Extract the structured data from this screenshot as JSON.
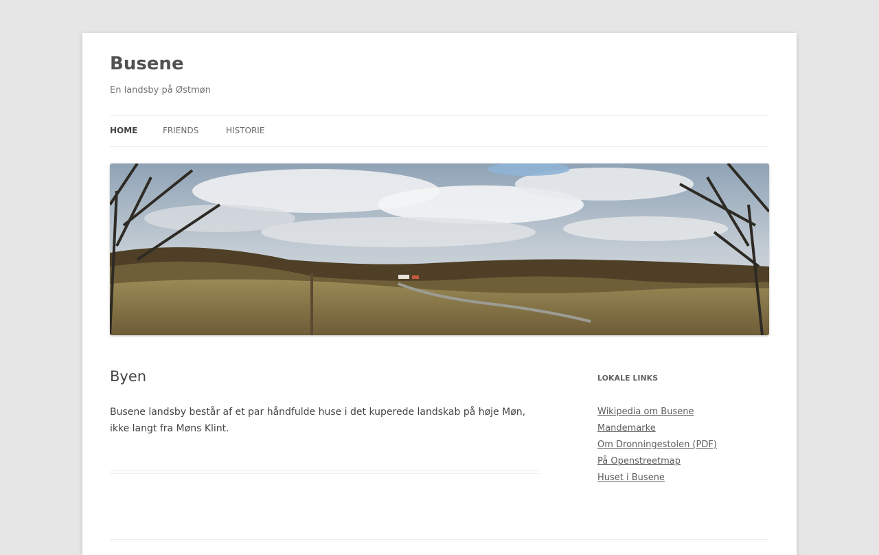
{
  "site": {
    "title": "Busene",
    "description": "En landsby på Østmøn"
  },
  "nav": {
    "items": [
      {
        "label": "Home",
        "current": true
      },
      {
        "label": "Friends",
        "current": false
      },
      {
        "label": "Historie",
        "current": false
      }
    ]
  },
  "header_image": {
    "subject": "landscape-photo",
    "colors": {
      "sky": "#b9c6d2",
      "cloud": "#eef0f2",
      "field": "#8a7a48",
      "forest": "#5a4a2c"
    }
  },
  "post": {
    "title": "Byen",
    "content": "Busene landsby består af et par håndfulde huse i det kuperede landskab på høje Møn, ikke langt fra Møns Klint."
  },
  "sidebar": {
    "widget_title": "Lokale links",
    "links": [
      {
        "label": "Wikipedia om Busene"
      },
      {
        "label": "Mandemarke"
      },
      {
        "label": "Om Dronningestolen (PDF)"
      },
      {
        "label": "På Openstreetmap"
      },
      {
        "label": "Huset i Busene"
      }
    ]
  }
}
